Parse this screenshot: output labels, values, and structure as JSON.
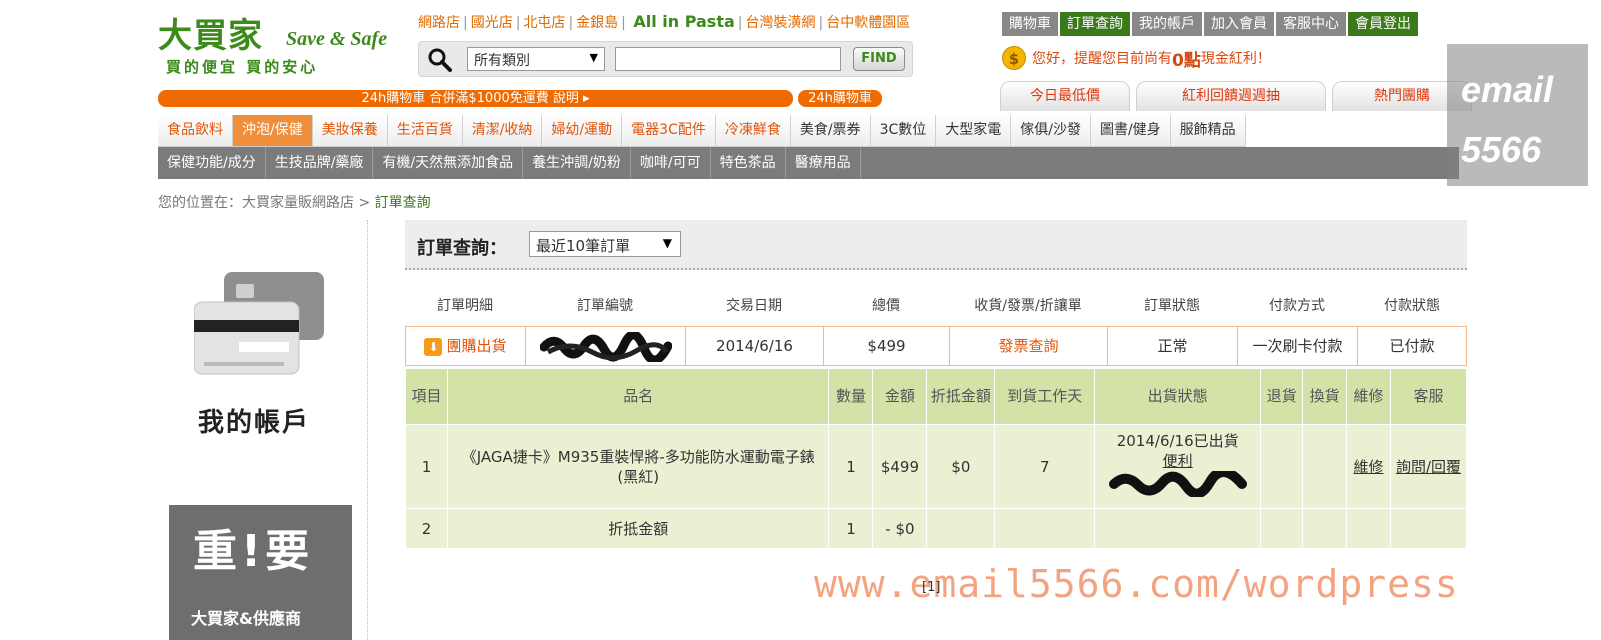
{
  "logo": {
    "big": "大買家",
    "en": "Save & Safe",
    "tagline": "買的便宜  買的安心"
  },
  "store_links": [
    "網路店",
    "國光店",
    "北屯店",
    "金銀島",
    "All in Pasta",
    "台灣裝潢網",
    "台中軟體園區"
  ],
  "search": {
    "category_value": "所有類別",
    "find_label": "FIND",
    "input_value": ""
  },
  "member_nav": [
    "購物車",
    "訂單查詢",
    "我的帳戶",
    "加入會員",
    "客服中心",
    "會員登出"
  ],
  "greeting": {
    "prefix": "您好，提醒您目前尚有",
    "points": "0點",
    "suffix": "現金紅利！"
  },
  "promo_tabs": [
    "今日最低價",
    "紅利回饋週週抽",
    "熱門團購"
  ],
  "free_ship_bar": "24h購物車  合併滿$1000免運費  說明 ▸",
  "hr24_badge": "24h購物車",
  "categories": [
    "食品飲料",
    "沖泡/保健",
    "美妝保養",
    "生活百貨",
    "清潔/收納",
    "婦幼/運動",
    "電器3C配件",
    "冷凍鮮食",
    "美食/票券",
    "3C數位",
    "大型家電",
    "傢俱/沙發",
    "圖書/健身",
    "服飾精品"
  ],
  "subcategories": [
    "保健功能/成分",
    "生技品牌/藥廠",
    "有機/天然無添加食品",
    "養生沖調/奶粉",
    "咖啡/可可",
    "特色茶品",
    "醫療用品"
  ],
  "watermark_box": {
    "line1": "email",
    "line2": "5566"
  },
  "breadcrumb": {
    "prefix": "您的位置在：大買家量販網路店",
    "sep": ">",
    "current": "訂單查詢"
  },
  "sidebar": {
    "my_account": "我的帳戶",
    "banner_big": "重!要",
    "banner_small": "大買家&供應商"
  },
  "order_query": {
    "label": "訂單查詢：",
    "range_value": "最近10筆訂單"
  },
  "summary": {
    "headers": [
      "訂單明細",
      "訂單編號",
      "交易日期",
      "總價",
      "收貨/發票/折讓單",
      "訂單狀態",
      "付款方式",
      "付款狀態"
    ],
    "row": {
      "detail": "團購出貨",
      "date": "2014/6/16",
      "total": "$499",
      "invoice": "發票查詢",
      "status": "正常",
      "payment": "一次刷卡付款",
      "pay_status": "已付款"
    }
  },
  "detail": {
    "headers": [
      "項目",
      "品名",
      "數量",
      "金額",
      "折抵金額",
      "到貨工作天",
      "出貨狀態",
      "退貨",
      "換貨",
      "維修",
      "客服"
    ],
    "rows": [
      {
        "item": "1",
        "name": "《JAGA捷卡》M935重裝悍將-多功能防水運動電子錶(黑紅)",
        "qty": "1",
        "amount": "$499",
        "discount": "$0",
        "days": "7",
        "ship_line1": "2014/6/16已出貨",
        "ship_line2": "便利",
        "repair": "維修",
        "service": "詢問/回覆"
      },
      {
        "item": "2",
        "name": "折抵金額",
        "qty": "1",
        "amount": "- $0"
      }
    ]
  },
  "pager": "[1]",
  "site_watermark": "www.email5566.com/wordpress"
}
